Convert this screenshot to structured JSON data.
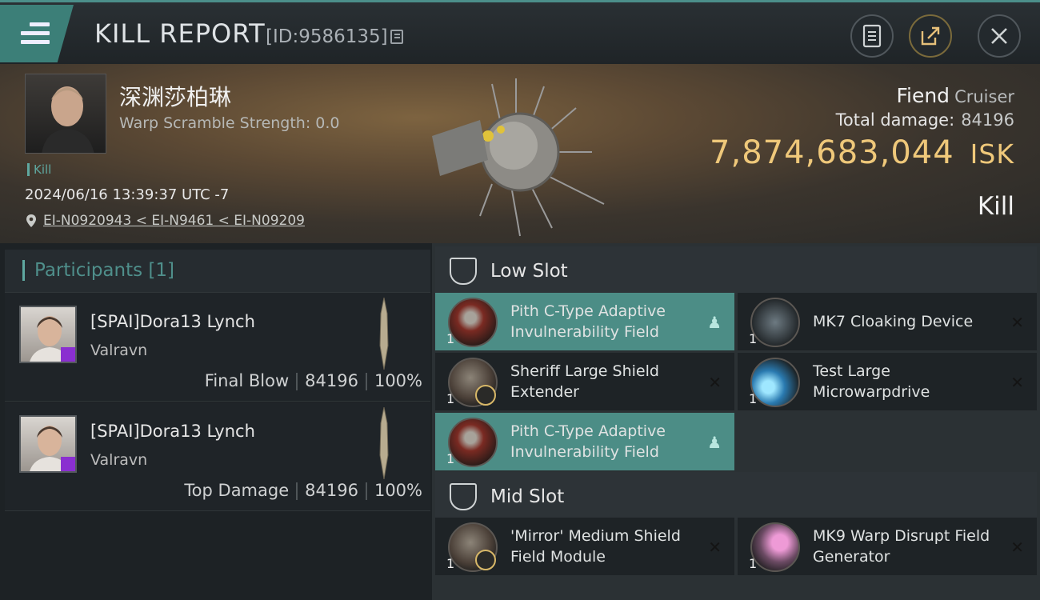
{
  "topbar": {
    "title": "KILL REPORT",
    "report_id": "[ID:9586135]",
    "menu_icon": "hamburger-icon",
    "buttons": [
      "report-icon",
      "share-icon",
      "close-icon"
    ]
  },
  "victim": {
    "name": "深渊莎柏琳",
    "warp_scramble": "Warp Scramble Strength: 0.0",
    "kill_tag": "Kill",
    "timestamp": "2024/06/16 13:39:37 UTC -7",
    "location": "EI-N0920943 < EI-N9461 < EI-N09209"
  },
  "ship": {
    "name": "Fiend",
    "class": "Cruiser",
    "total_damage_label": "Total damage:",
    "total_damage": "84196",
    "isk_value": "7,874,683,044",
    "isk_unit": "ISK",
    "result": "Kill"
  },
  "participants": {
    "label": "Participants [1]",
    "rows": [
      {
        "name": "[SPAI]Dora13 Lynch",
        "corp": "Valravn",
        "role": "Final Blow",
        "damage": "84196",
        "percent": "100%"
      },
      {
        "name": "[SPAI]Dora13 Lynch",
        "corp": "Valravn",
        "role": "Top Damage",
        "damage": "84196",
        "percent": "100%"
      }
    ]
  },
  "slots": {
    "low": {
      "label": "Low Slot",
      "modules": [
        {
          "qty": "1",
          "name": "Pith C-Type Adaptive Invulnerability Field",
          "highlight": true
        },
        {
          "qty": "1",
          "name": "MK7 Cloaking Device",
          "highlight": false
        },
        {
          "qty": "1",
          "name": "Sheriff Large Shield Extender",
          "highlight": false
        },
        {
          "qty": "1",
          "name": "Test Large Microwarpdrive",
          "highlight": false
        },
        {
          "qty": "1",
          "name": "Pith C-Type Adaptive Invulnerability Field",
          "highlight": true
        }
      ]
    },
    "mid": {
      "label": "Mid Slot",
      "modules": [
        {
          "qty": "1",
          "name": "'Mirror' Medium Shield Field Module",
          "highlight": false
        },
        {
          "qty": "1",
          "name": "MK9 Warp Disrupt Field Generator",
          "highlight": false
        }
      ]
    }
  },
  "colors": {
    "accent": "#4c8d86",
    "isk": "#efc87a"
  }
}
